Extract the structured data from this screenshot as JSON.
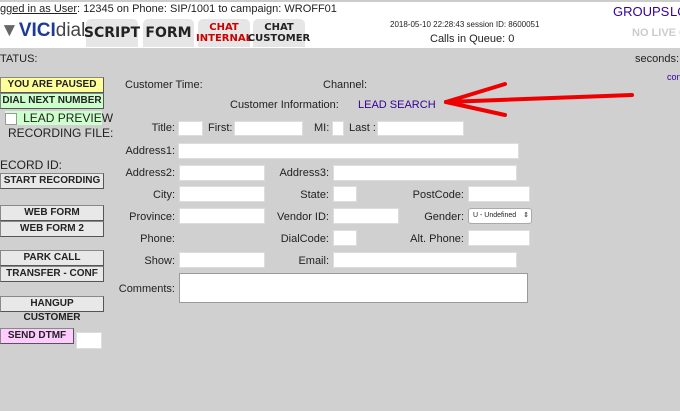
{
  "header": {
    "login_prefix": "gged in as User",
    "login_rest": ": 12345 on Phone: SIP/1001  to campaign: WROFF01",
    "logo_bold": "VICI",
    "logo_light": "dial",
    "datetime": "2018-05-10 22:28:43   session ID: 8600051",
    "queue": "Calls in Queue: 0",
    "groups": "GROUPS",
    "logout": "LO",
    "no_live": "NO LIVE C"
  },
  "tabs": [
    {
      "label": "SCRIPT"
    },
    {
      "label": "FORM"
    },
    {
      "label": "CHAT\nINTERNAL",
      "l1": "CHAT",
      "l2": "INTERNAL"
    },
    {
      "l1": "CHAT",
      "l2": "CUSTOMER"
    }
  ],
  "status": {
    "label": "TATUS:",
    "seconds": "seconds:",
    "con": "con"
  },
  "left": {
    "paused": "YOU ARE PAUSED",
    "dial_next": "DIAL NEXT NUMBER",
    "lead_preview": "LEAD PREVIEW",
    "recording_file": "RECORDING FILE:",
    "record_id": "ECORD ID:",
    "start_recording": "START RECORDING",
    "web_form": "WEB FORM",
    "web_form_2": "WEB FORM 2",
    "park_call": "PARK CALL",
    "transfer": "TRANSFER - CONF",
    "hangup": "HANGUP CUSTOMER",
    "send_dtmf": "SEND DTMF"
  },
  "form": {
    "customer_time": "Customer Time:",
    "channel": "Channel:",
    "customer_info": "Customer Information:",
    "lead_search": "LEAD SEARCH",
    "title": "Title:",
    "first": "First:",
    "mi": "MI:",
    "last": "Last :",
    "address1": "Address1:",
    "address2": "Address2:",
    "address3": "Address3:",
    "city": "City:",
    "state": "State:",
    "postcode": "PostCode:",
    "province": "Province:",
    "vendor_id": "Vendor ID:",
    "gender": "Gender:",
    "gender_value": "U - Undefined",
    "phone": "Phone:",
    "dialcode": "DialCode:",
    "alt_phone": "Alt. Phone:",
    "show": "Show:",
    "email": "Email:",
    "comments": "Comments:"
  },
  "colors": {
    "paused": "#ffff99",
    "dial": "#ccffcc",
    "dtmf": "#ffccff",
    "chat_internal": "#cc0000",
    "arrow": "#ee0000"
  }
}
